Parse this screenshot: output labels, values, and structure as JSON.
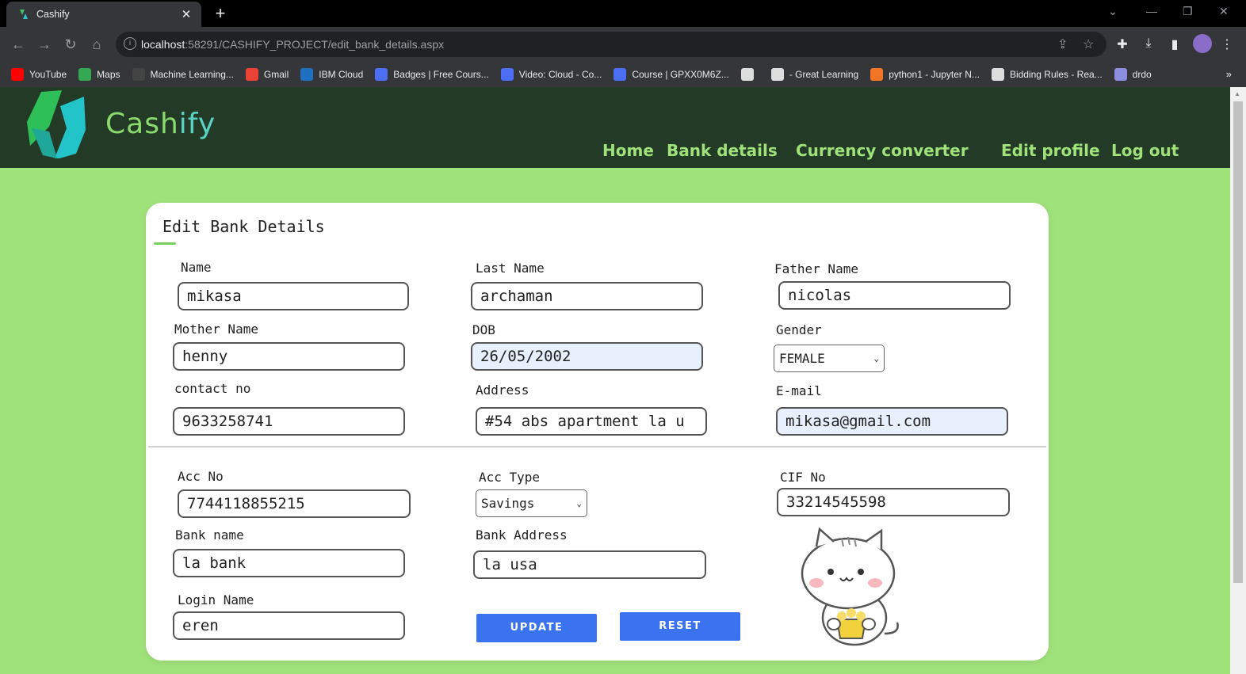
{
  "browser": {
    "tab_title": "Cashify",
    "url_host": "localhost",
    "url_rest": ":58291/CASHIFY_PROJECT/edit_bank_details.aspx",
    "bookmarks": [
      {
        "label": "YouTube",
        "color": "#ff0000"
      },
      {
        "label": "Maps",
        "color": "#34a853"
      },
      {
        "label": "Machine Learning...",
        "color": "#444444"
      },
      {
        "label": "Gmail",
        "color": "#ea4335"
      },
      {
        "label": "IBM Cloud",
        "color": "#1f70c1"
      },
      {
        "label": "Badges | Free Cours...",
        "color": "#4c6ef5"
      },
      {
        "label": "Video: Cloud - Co...",
        "color": "#4c6ef5"
      },
      {
        "label": "Course | GPXX0M6Z...",
        "color": "#4c6ef5"
      },
      {
        "label": "",
        "color": "#dddddd"
      },
      {
        "label": "- Great Learning",
        "color": "#dddddd"
      },
      {
        "label": "python1 - Jupyter N...",
        "color": "#f37626"
      },
      {
        "label": "Bidding Rules - Rea...",
        "color": "#dddddd"
      },
      {
        "label": "drdo",
        "color": "#8e8ede"
      }
    ],
    "more_bookmarks": "»"
  },
  "site": {
    "brand_a": "Cash",
    "brand_b": "i",
    "brand_c": "fy",
    "nav": [
      "Home",
      "Bank details",
      "Currency converter",
      "Edit profile",
      "Log out"
    ]
  },
  "form": {
    "title": "Edit Bank Details",
    "name_label": "Name",
    "name_value": "mikasa",
    "last_name_label": "Last Name",
    "last_name_value": "archaman",
    "father_name_label": "Father Name",
    "father_name_value": "nicolas",
    "mother_name_label": "Mother Name",
    "mother_name_value": "henny",
    "dob_label": "DOB",
    "dob_value": "26/05/2002",
    "gender_label": "Gender",
    "gender_value": "FEMALE",
    "contact_label": "contact no",
    "contact_value": "9633258741",
    "address_label": "Address",
    "address_value": "#54 abs apartment la u",
    "email_label": "E-mail",
    "email_value": "mikasa@gmail.com",
    "acc_no_label": "Acc No",
    "acc_no_value": "7744118855215",
    "acc_type_label": "Acc Type",
    "acc_type_value": "Savings",
    "cif_label": "CIF No",
    "cif_value": "33214545598",
    "bank_name_label": "Bank name",
    "bank_name_value": "la bank",
    "bank_address_label": "Bank Address",
    "bank_address_value": "la usa",
    "login_name_label": "Login Name",
    "login_name_value": "eren",
    "update_label": "UPDATE",
    "reset_label": "RESET"
  },
  "colors": {
    "header_bg": "#233b26",
    "page_bg": "#a0e27a",
    "accent": "#3a72ef"
  }
}
